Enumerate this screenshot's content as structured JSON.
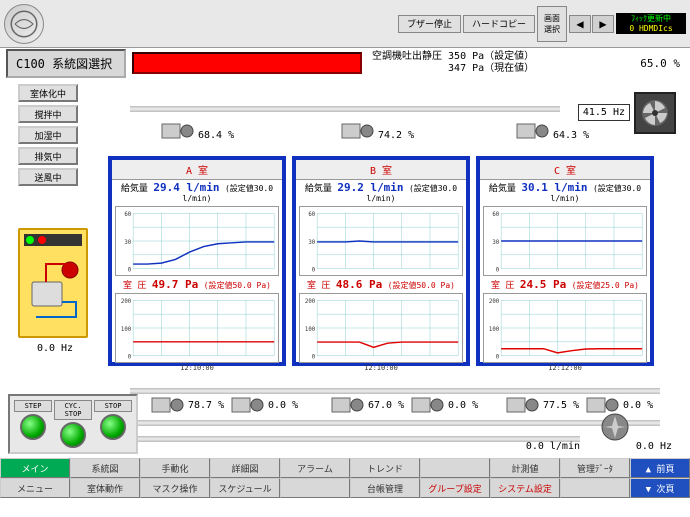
{
  "header": {
    "buzzer_btn": "ブザー停止",
    "hardcopy_btn": "ハードコピー",
    "screen_sel_btn": "画面\n選択",
    "status_line1": "ﾌｨｯｸ更新中",
    "status_line2": "0   HDMDIcs"
  },
  "title": "C100 系統図選択",
  "pressure": {
    "label": "空調機吐出静圧",
    "set_value": "350 Pa（設定値）",
    "cur_value": "347 Pa（現在値）"
  },
  "pct_top_right": "65.0 %",
  "fan_hz": "41.5 Hz",
  "side_buttons": [
    "室体化中",
    "撹拌中",
    "加湿中",
    "排気中",
    "送風中"
  ],
  "compressor_hz": "0.0 Hz",
  "top_dampers": [
    {
      "pct": "68.4 %"
    },
    {
      "pct": "74.2 %"
    },
    {
      "pct": "64.3 %"
    }
  ],
  "bottom_dampers": [
    {
      "pct1": "78.7 %",
      "pct2": "0.0 %"
    },
    {
      "pct1": "67.0 %",
      "pct2": "0.0 %"
    },
    {
      "pct1": "77.5 %",
      "pct2": "0.0 %"
    }
  ],
  "rooms": [
    {
      "name": "A 室",
      "flow_label": "給気量",
      "flow_val": "29.4 l/min",
      "flow_set": "(設定値30.0 l/min)",
      "p_label": "室 圧",
      "p_val": "49.7 Pa",
      "p_set": "(設定値50.0 Pa)",
      "time": "12:10:00"
    },
    {
      "name": "B 室",
      "flow_label": "給気量",
      "flow_val": "29.2 l/min",
      "flow_set": "(設定値30.0 l/min)",
      "p_label": "室 圧",
      "p_val": "48.6 Pa",
      "p_set": "(設定値50.0 Pa)",
      "time": "12:10:00"
    },
    {
      "name": "C 室",
      "flow_label": "給気量",
      "flow_val": "30.1 l/min",
      "flow_set": "(設定値30.0 l/min)",
      "p_label": "室 圧",
      "p_val": "24.5 Pa",
      "p_set": "(設定値25.0 Pa)",
      "time": "12:12:00"
    }
  ],
  "bottom_flow": "0.0 l/min",
  "bottom_hz": "0.0 Hz",
  "control_buttons": [
    "STEP",
    "CYC. STOP",
    "STOP"
  ],
  "footer_row1": [
    "メイン",
    "系統図",
    "手動化",
    "詳細図",
    "アラーム",
    "トレンド",
    "",
    "計測値",
    "管理ﾃﾞｰﾀ"
  ],
  "footer_row2": [
    "メニュー",
    "室体動作",
    "マスク操作",
    "スケジュール",
    "",
    "台帳管理",
    "グループ設定",
    "システム設定",
    ""
  ],
  "footer_right": [
    "▲ 前頁",
    "▼ 次頁"
  ],
  "chart_data": [
    {
      "type": "line",
      "title": "A室 給気量",
      "ylabel": "l/min",
      "ylim": [
        0,
        60
      ],
      "grid": true,
      "x": [
        0,
        1,
        2,
        3,
        4,
        5,
        6,
        7,
        8,
        9,
        10
      ],
      "series": [
        {
          "name": "給気量",
          "color": "#1030c0",
          "values": [
            5,
            5,
            6,
            10,
            18,
            24,
            27,
            28,
            29,
            29,
            29
          ]
        }
      ],
      "xticklabel": "12:10:00"
    },
    {
      "type": "line",
      "title": "A室 室圧",
      "ylabel": "Pa",
      "ylim": [
        0,
        200
      ],
      "grid": true,
      "x": [
        0,
        1,
        2,
        3,
        4,
        5,
        6,
        7,
        8,
        9,
        10
      ],
      "series": [
        {
          "name": "室圧",
          "color": "#e00000",
          "values": [
            50,
            50,
            50,
            50,
            50,
            50,
            50,
            50,
            50,
            50,
            50
          ]
        }
      ],
      "xticklabel": "12:10:00"
    },
    {
      "type": "line",
      "title": "B室 給気量",
      "ylabel": "l/min",
      "ylim": [
        0,
        60
      ],
      "grid": true,
      "x": [
        0,
        1,
        2,
        3,
        4,
        5,
        6,
        7,
        8,
        9,
        10
      ],
      "series": [
        {
          "name": "給気量",
          "color": "#1030c0",
          "values": [
            29,
            29,
            29,
            30,
            29,
            29,
            29,
            29,
            29,
            29,
            29
          ]
        }
      ],
      "xticklabel": "12:10:00"
    },
    {
      "type": "line",
      "title": "B室 室圧",
      "ylabel": "Pa",
      "ylim": [
        0,
        200
      ],
      "grid": true,
      "x": [
        0,
        1,
        2,
        3,
        4,
        5,
        6,
        7,
        8,
        9,
        10
      ],
      "series": [
        {
          "name": "室圧",
          "color": "#e00000",
          "values": [
            49,
            49,
            49,
            49,
            30,
            45,
            49,
            49,
            49,
            49,
            49
          ]
        }
      ],
      "xticklabel": "12:10:00"
    },
    {
      "type": "line",
      "title": "C室 給気量",
      "ylabel": "l/min",
      "ylim": [
        0,
        60
      ],
      "grid": true,
      "x": [
        0,
        1,
        2,
        3,
        4,
        5,
        6,
        7,
        8,
        9,
        10
      ],
      "series": [
        {
          "name": "給気量",
          "color": "#1030c0",
          "values": [
            30,
            30,
            30,
            30,
            30,
            30,
            30,
            30,
            30,
            30,
            30
          ]
        }
      ],
      "xticklabel": "12:12:00"
    },
    {
      "type": "line",
      "title": "C室 室圧",
      "ylabel": "Pa",
      "ylim": [
        0,
        200
      ],
      "grid": true,
      "x": [
        0,
        1,
        2,
        3,
        4,
        5,
        6,
        7,
        8,
        9,
        10
      ],
      "series": [
        {
          "name": "室圧",
          "color": "#e00000",
          "values": [
            25,
            25,
            25,
            25,
            10,
            18,
            24,
            25,
            25,
            25,
            25
          ]
        }
      ],
      "xticklabel": "12:12:00"
    }
  ]
}
